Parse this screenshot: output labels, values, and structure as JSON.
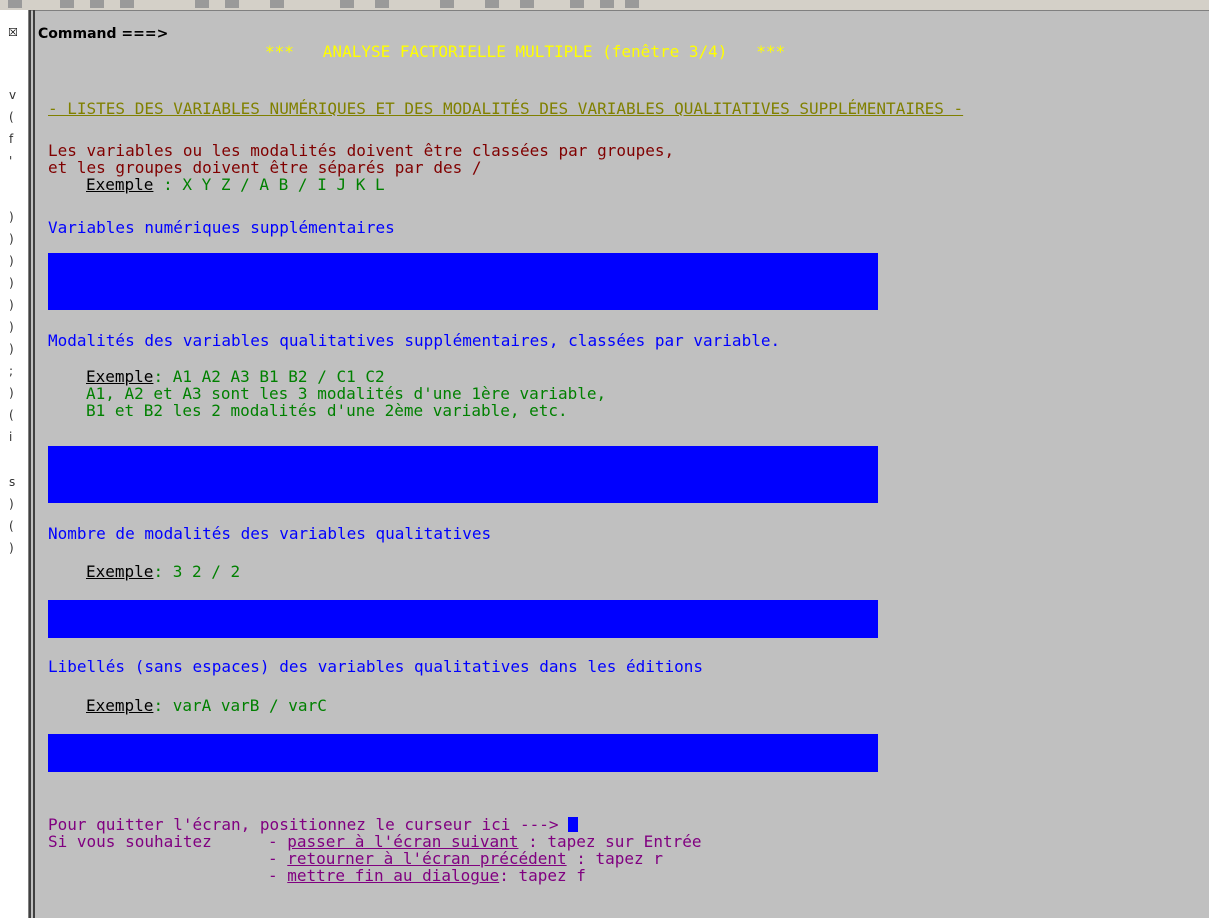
{
  "command_label": "Command ===>",
  "title": "***   ANALYSE FACTORIELLE MULTIPLE (fenêtre 3/4)   ***",
  "section_header": "- LISTES DES VARIABLES NUMÉRIQUES ET DES MODALITÉS DES VARIABLES QUALITATIVES SUPPLÉMENTAIRES -",
  "instructions": {
    "line1": "Les variables ou les modalités doivent être classées par groupes,",
    "line2": "et les groupes doivent être séparés par des /",
    "example_word": "Exemple",
    "example_text": " : X Y Z / A B / I J K L"
  },
  "sections": [
    {
      "label": "Variables numériques supplémentaires",
      "value": ""
    },
    {
      "label": "Modalités des variables qualitatives supplémentaires, classées par variable.",
      "example_word": "Exemple",
      "example_text": ": A1 A2 A3 B1 B2 / C1 C2",
      "example_line2": "A1, A2 et A3 sont les 3 modalités d'une 1ère variable,",
      "example_line3": "B1 et B2 les 2 modalités d'une 2ème variable, etc.",
      "value": ""
    },
    {
      "label": "Nombre de modalités des variables qualitatives",
      "example_word": "Exemple",
      "example_text": ": 3 2 / 2",
      "value": ""
    },
    {
      "label": "Libellés (sans espaces) des variables qualitatives dans les éditions",
      "example_word": "Exemple",
      "example_text": ": varA varB / varC",
      "value": ""
    }
  ],
  "footer": {
    "quit_text": "Pour quitter l'écran, positionnez le curseur ici --->",
    "wish_text": "Si vous souhaitez",
    "options": [
      {
        "dash": "- ",
        "link": "passer à l'écran suivant",
        "rest": " : tapez sur Entrée"
      },
      {
        "dash": "- ",
        "link": "retourner à l'écran précédent",
        "rest": " : tapez r"
      },
      {
        "dash": "- ",
        "link": "mettre fin au dialogue",
        "rest": ": tapez f"
      }
    ]
  },
  "colors": {
    "background": "#c0c0c0",
    "field": "#0000ff",
    "title": "#ffff00",
    "header": "#808000",
    "instructions": "#800000",
    "example": "#008000",
    "label": "#0000ff",
    "footer": "#800080"
  }
}
